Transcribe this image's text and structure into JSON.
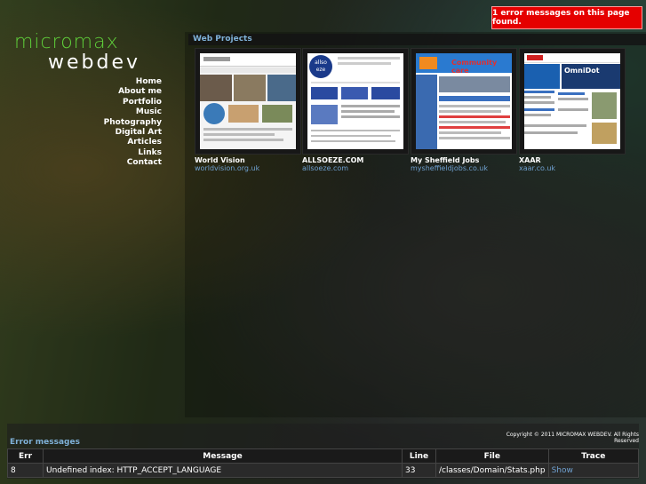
{
  "error_banner": "1 error messages on this page found.",
  "logo": {
    "line1": "micromax",
    "line2": "webdev"
  },
  "nav": [
    "Home",
    "About me",
    "Portfolio",
    "Music",
    "Photography",
    "Digital Art",
    "Articles",
    "Links",
    "Contact"
  ],
  "section_title": "Web Projects",
  "projects": [
    {
      "title": "World Vision",
      "url": "worldvision.org.uk"
    },
    {
      "title": "ALLSOEZE.COM",
      "url": "allsoeze.com"
    },
    {
      "title": "My Sheffield Jobs",
      "url": "mysheffieldjobs.co.uk"
    },
    {
      "title": "XAAR",
      "url": "xaar.co.uk"
    }
  ],
  "thumb_text": {
    "allsoeze_logo": "allso eze",
    "sheffield_banner": "Community care",
    "xaar_banner": "OmniDot"
  },
  "copyright": "Copyright © 2011 MICROMAX WEBDEV. All Rights Reserved",
  "errors": {
    "title": "Error messages",
    "headers": [
      "Err",
      "Message",
      "Line",
      "File",
      "Trace"
    ],
    "rows": [
      {
        "err": "8",
        "message": "Undefined index: HTTP_ACCEPT_LANGUAGE",
        "line": "33",
        "file": "/classes/Domain/Stats.php",
        "trace": "Show"
      }
    ]
  },
  "colors": {
    "accent_green": "#5fcf3a",
    "link_blue": "#6fa0d0",
    "error_red": "#e50000"
  }
}
